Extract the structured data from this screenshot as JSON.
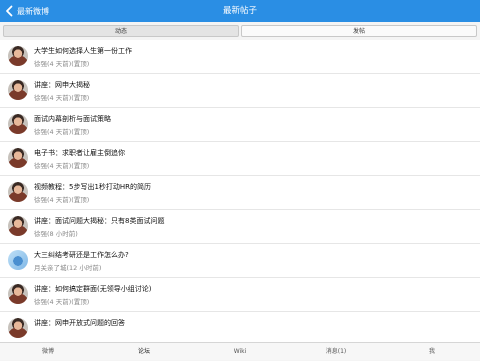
{
  "navbar": {
    "back_label": "最新微博",
    "title": "最新帖子"
  },
  "segments": [
    {
      "label": "动态",
      "selected": true
    },
    {
      "label": "发帖",
      "selected": false
    }
  ],
  "posts": [
    {
      "title": "大学生如何选择人生第一份工作",
      "meta": "徐强(4 天前)(置顶)",
      "avatar": "person-avatar"
    },
    {
      "title": "讲座：网申大揭秘",
      "meta": "徐强(4 天前)(置顶)",
      "avatar": "person-avatar"
    },
    {
      "title": "面试内幕剖析与面试策略",
      "meta": "徐强(4 天前)(置顶)",
      "avatar": "person-avatar"
    },
    {
      "title": "电子书：求职者让雇主倒追你",
      "meta": "徐强(4 天前)(置顶)",
      "avatar": "person-avatar"
    },
    {
      "title": "视频教程：5步写出1秒打动HR的简历",
      "meta": "徐强(4 天前)(置顶)",
      "avatar": "person-avatar"
    },
    {
      "title": "讲座：面试问题大揭秘：只有8类面试问题",
      "meta": "徐强(8 小时前)",
      "avatar": "person-avatar"
    },
    {
      "title": "大三纠结考研还是工作怎么办?",
      "meta": "月关亲了城(12 小时前)",
      "avatar": "bird-avatar"
    },
    {
      "title": "讲座：如何搞定群面(无领导小组讨论)",
      "meta": "徐强(4 天前)(置顶)",
      "avatar": "person-avatar"
    },
    {
      "title": "讲座：网申开放式问题的回答",
      "meta": "",
      "avatar": "person-avatar"
    }
  ],
  "tabbar": {
    "items": [
      {
        "label": "微博",
        "selected": false
      },
      {
        "label": "论坛",
        "selected": true
      },
      {
        "label": "Wiki",
        "selected": false
      },
      {
        "label": "消息(1)",
        "selected": false
      },
      {
        "label": "我",
        "selected": false
      }
    ]
  },
  "colors": {
    "navbar_bg": "#2a8ee4",
    "text_primary": "#111111",
    "text_secondary": "#888888"
  }
}
